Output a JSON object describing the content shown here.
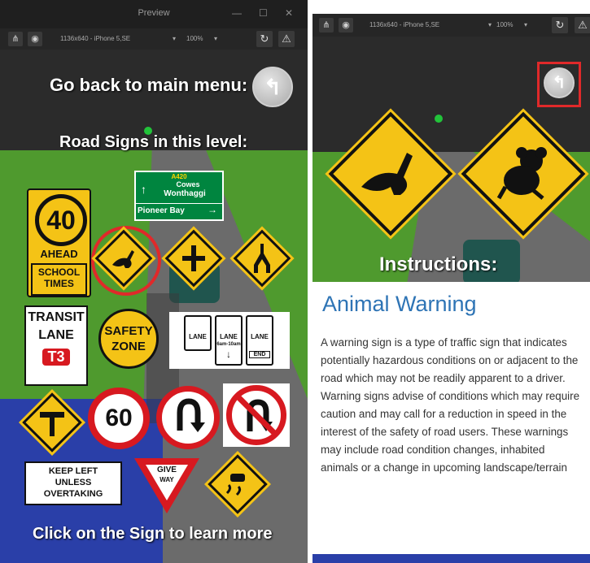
{
  "left": {
    "window_title": "Preview",
    "toolbar": {
      "device": "1136x640 - iPhone 5,SE",
      "zoom": "100%"
    },
    "back_text": "Go back to main menu:",
    "road_signs_heading": "Road Signs in this level:",
    "footer": "Click on the Sign  to learn more",
    "signs": {
      "speed_40": "40",
      "ahead": "AHEAD",
      "school_times": "SCHOOL\nTIMES",
      "a420": "A420",
      "cowes": "Cowes",
      "wonthaggi": "Wonthaggi",
      "pioneer_bay": "Pioneer Bay",
      "transit": "TRANSIT",
      "lane": "LANE",
      "t3": "T3",
      "safety": "SAFETY",
      "zone": "ZONE",
      "lane1": "LANE",
      "lane2": "LANE",
      "lane2_time": "6am-10am",
      "lane3": "LANE",
      "end": "END",
      "speed_60": "60",
      "keep_left": "KEEP LEFT",
      "unless": "UNLESS",
      "overtaking": "OVERTAKING",
      "give_way_1": "GIVE",
      "give_way_2": "WAY"
    }
  },
  "right": {
    "toolbar": {
      "device": "1136x640 - iPhone 5,SE",
      "zoom": "100%"
    },
    "instructions_heading": "Instructions:",
    "title": "Animal Warning",
    "body": "A warning sign is a type of traffic sign that indicates potentially hazardous conditions on or adjacent to the road which may not be readily apparent to a driver. Warning signs advise of conditions which may require caution and may call for a reduction in speed in the interest of the safety of road users. These warnings may include road condition changes, inhabited animals or a change in upcoming landscape/terrain"
  },
  "colors": {
    "sign_yellow": "#f4c316",
    "sign_red": "#d71920",
    "guide_green": "#00853f",
    "title_blue": "#2e74b5",
    "highlight_red": "#e0292a"
  },
  "icons": [
    "hierarchy-icon",
    "camera-icon",
    "refresh-icon",
    "warning-icon",
    "back-arrow-icon"
  ]
}
